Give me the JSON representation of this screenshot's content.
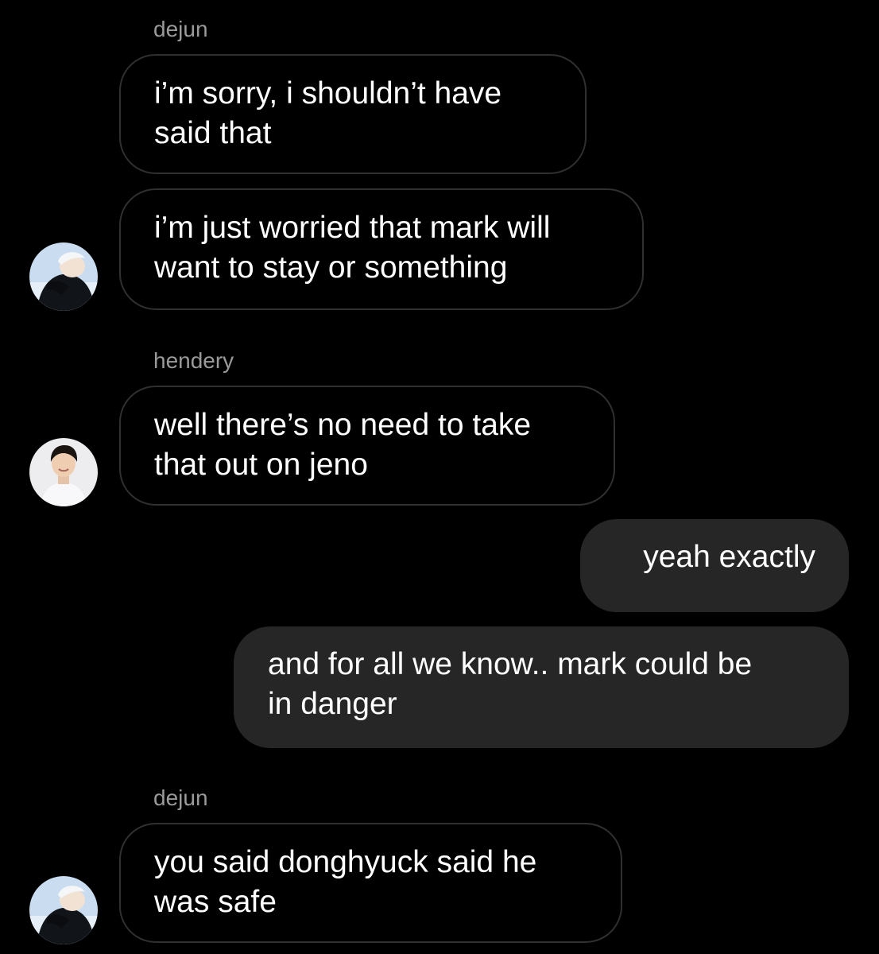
{
  "conversation": {
    "messages": [
      {
        "sender": "dejun",
        "text": "i’m sorry, i shouldn’t have\nsaid that"
      },
      {
        "text": "i’m just worried that mark will\nwant to stay or something"
      },
      {
        "sender": "hendery",
        "text": "well there’s no need to take\nthat out on jeno"
      },
      {
        "outgoing": true,
        "text": "yeah exactly"
      },
      {
        "outgoing": true,
        "text": "and for all we know.. mark could be\nin danger"
      },
      {
        "sender": "dejun",
        "text": "you said donghyuck said he\nwas safe"
      }
    ]
  },
  "avatars": {
    "dejun": {
      "icon": "profile-photo-dejun",
      "color": "#c9dcf0"
    },
    "hendery": {
      "icon": "profile-photo-hendery",
      "color": "#ededf0"
    }
  },
  "colors": {
    "background": "#000000",
    "incoming_border": "#303030",
    "outgoing_fill": "#262626",
    "sender_name": "#9a9a9a"
  }
}
